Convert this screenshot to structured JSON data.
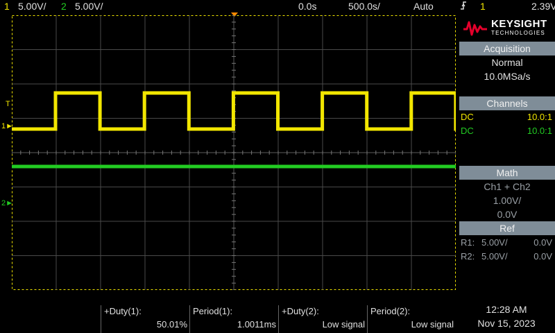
{
  "topbar": {
    "ch1_num": "1",
    "ch1_scale": "5.00V/",
    "ch2_num": "2",
    "ch2_scale": "5.00V/",
    "time_delay": "0.0s",
    "time_scale": "500.0s/",
    "trigger_mode": "Auto",
    "trigger_icon": "edge-trigger-icon",
    "trigger_source": "1",
    "trigger_level": "2.39V"
  },
  "markers": {
    "trigger": "T",
    "ch1": "1",
    "ch2": "2"
  },
  "logo": {
    "brand": "KEYSIGHT",
    "sub": "TECHNOLOGIES"
  },
  "acquisition": {
    "header": "Acquisition",
    "mode": "Normal",
    "rate": "10.0MSa/s"
  },
  "channels": {
    "header": "Channels",
    "rows": [
      {
        "coupling": "DC",
        "probe": "10.0:1"
      },
      {
        "coupling": "DC",
        "probe": "10.0:1"
      }
    ]
  },
  "math": {
    "header": "Math",
    "expr": "Ch1 + Ch2",
    "scale": "1.00V/",
    "offset": "0.0V"
  },
  "ref": {
    "header": "Ref",
    "rows": [
      {
        "name": "R1:",
        "scale": "5.00V/",
        "offset": "0.0V"
      },
      {
        "name": "R2:",
        "scale": "5.00V/",
        "offset": "0.0V"
      }
    ]
  },
  "measurements": [
    {
      "name": "+Duty(1):",
      "value": "50.01%"
    },
    {
      "name": "Period(1):",
      "value": "1.0011ms"
    },
    {
      "name": "+Duty(2):",
      "value": "Low signal"
    },
    {
      "name": "Period(2):",
      "value": "Low signal"
    }
  ],
  "clock": {
    "time": "12:28 AM",
    "date": "Nov 15, 2023"
  },
  "colors": {
    "ch1": "#f2e600",
    "ch2": "#22cc22",
    "grid": "#4a4a4a",
    "panel_header": "#7f8d98",
    "trigger": "#ff8a00"
  }
}
